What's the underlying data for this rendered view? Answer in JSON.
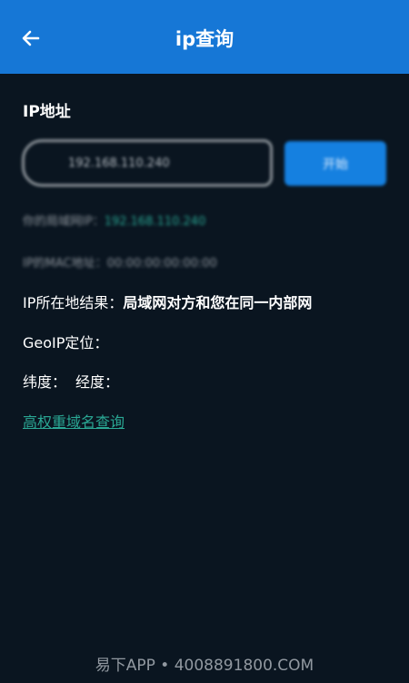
{
  "header": {
    "title": "ip查询"
  },
  "section": {
    "label": "IP地址"
  },
  "input": {
    "value": "192.168.110.240"
  },
  "query_button": {
    "label": "开始"
  },
  "results": {
    "local_ip_label": "你的局域网IP：",
    "local_ip_value": "192.168.110.240",
    "mac_label": "IP的MAC地址：",
    "mac_value": "00:00:00:00:00:00",
    "location_label": "IP所在地结果：",
    "location_value": "局域网对方和您在同一内部网",
    "geoip_label": "GeoIP定位：",
    "latitude_label": "纬度：",
    "longitude_label": "经度："
  },
  "link": {
    "label": "高权重域名查询"
  },
  "watermark": {
    "text": "易下APP • 4008891800.COM"
  },
  "colors": {
    "app_bar": "#1677d6",
    "background": "#0a1520",
    "accent_link": "#2aa894",
    "button": "#1580e0"
  },
  "icons": {
    "back": "arrow-left-icon"
  }
}
